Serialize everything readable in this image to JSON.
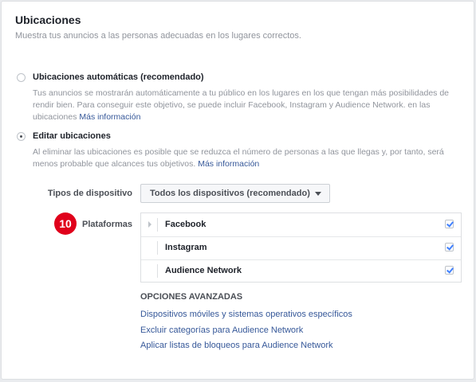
{
  "header": {
    "title": "Ubicaciones",
    "subtitle": "Muestra tus anuncios a las personas adecuadas en los lugares correctos."
  },
  "options": {
    "automatic": {
      "label": "Ubicaciones automáticas (recomendado)",
      "description": "Tus anuncios se mostrarán automáticamente a tu público en los lugares en los que tengan más posibilidades de rendir bien. Para conseguir este objetivo, se puede incluir Facebook, Instagram y Audience Network. en las ubicaciones",
      "more_info": "Más información",
      "selected": false
    },
    "edit": {
      "label": "Editar ubicaciones",
      "description": "Al eliminar las ubicaciones es posible que se reduzca el número de personas a las que llegas y, por tanto, será menos probable que alcances tus objetivos.",
      "more_info": "Más información",
      "selected": true
    }
  },
  "devices": {
    "label": "Tipos de dispositivo",
    "selected_value": "Todos los dispositivos (recomendado)"
  },
  "platforms": {
    "step_badge": "10",
    "label": "Plataformas",
    "items": [
      {
        "name": "Facebook",
        "checked": true,
        "expandable": true
      },
      {
        "name": "Instagram",
        "checked": true,
        "expandable": false
      },
      {
        "name": "Audience Network",
        "checked": true,
        "expandable": false
      }
    ]
  },
  "advanced": {
    "title": "OPCIONES AVANZADAS",
    "links": [
      "Dispositivos móviles y sistemas operativos específicos",
      "Excluir categorías para Audience Network",
      "Aplicar listas de bloqueos para Audience Network"
    ]
  },
  "colors": {
    "link": "#365899",
    "badge": "#e0001b",
    "check": "#4080ff"
  }
}
